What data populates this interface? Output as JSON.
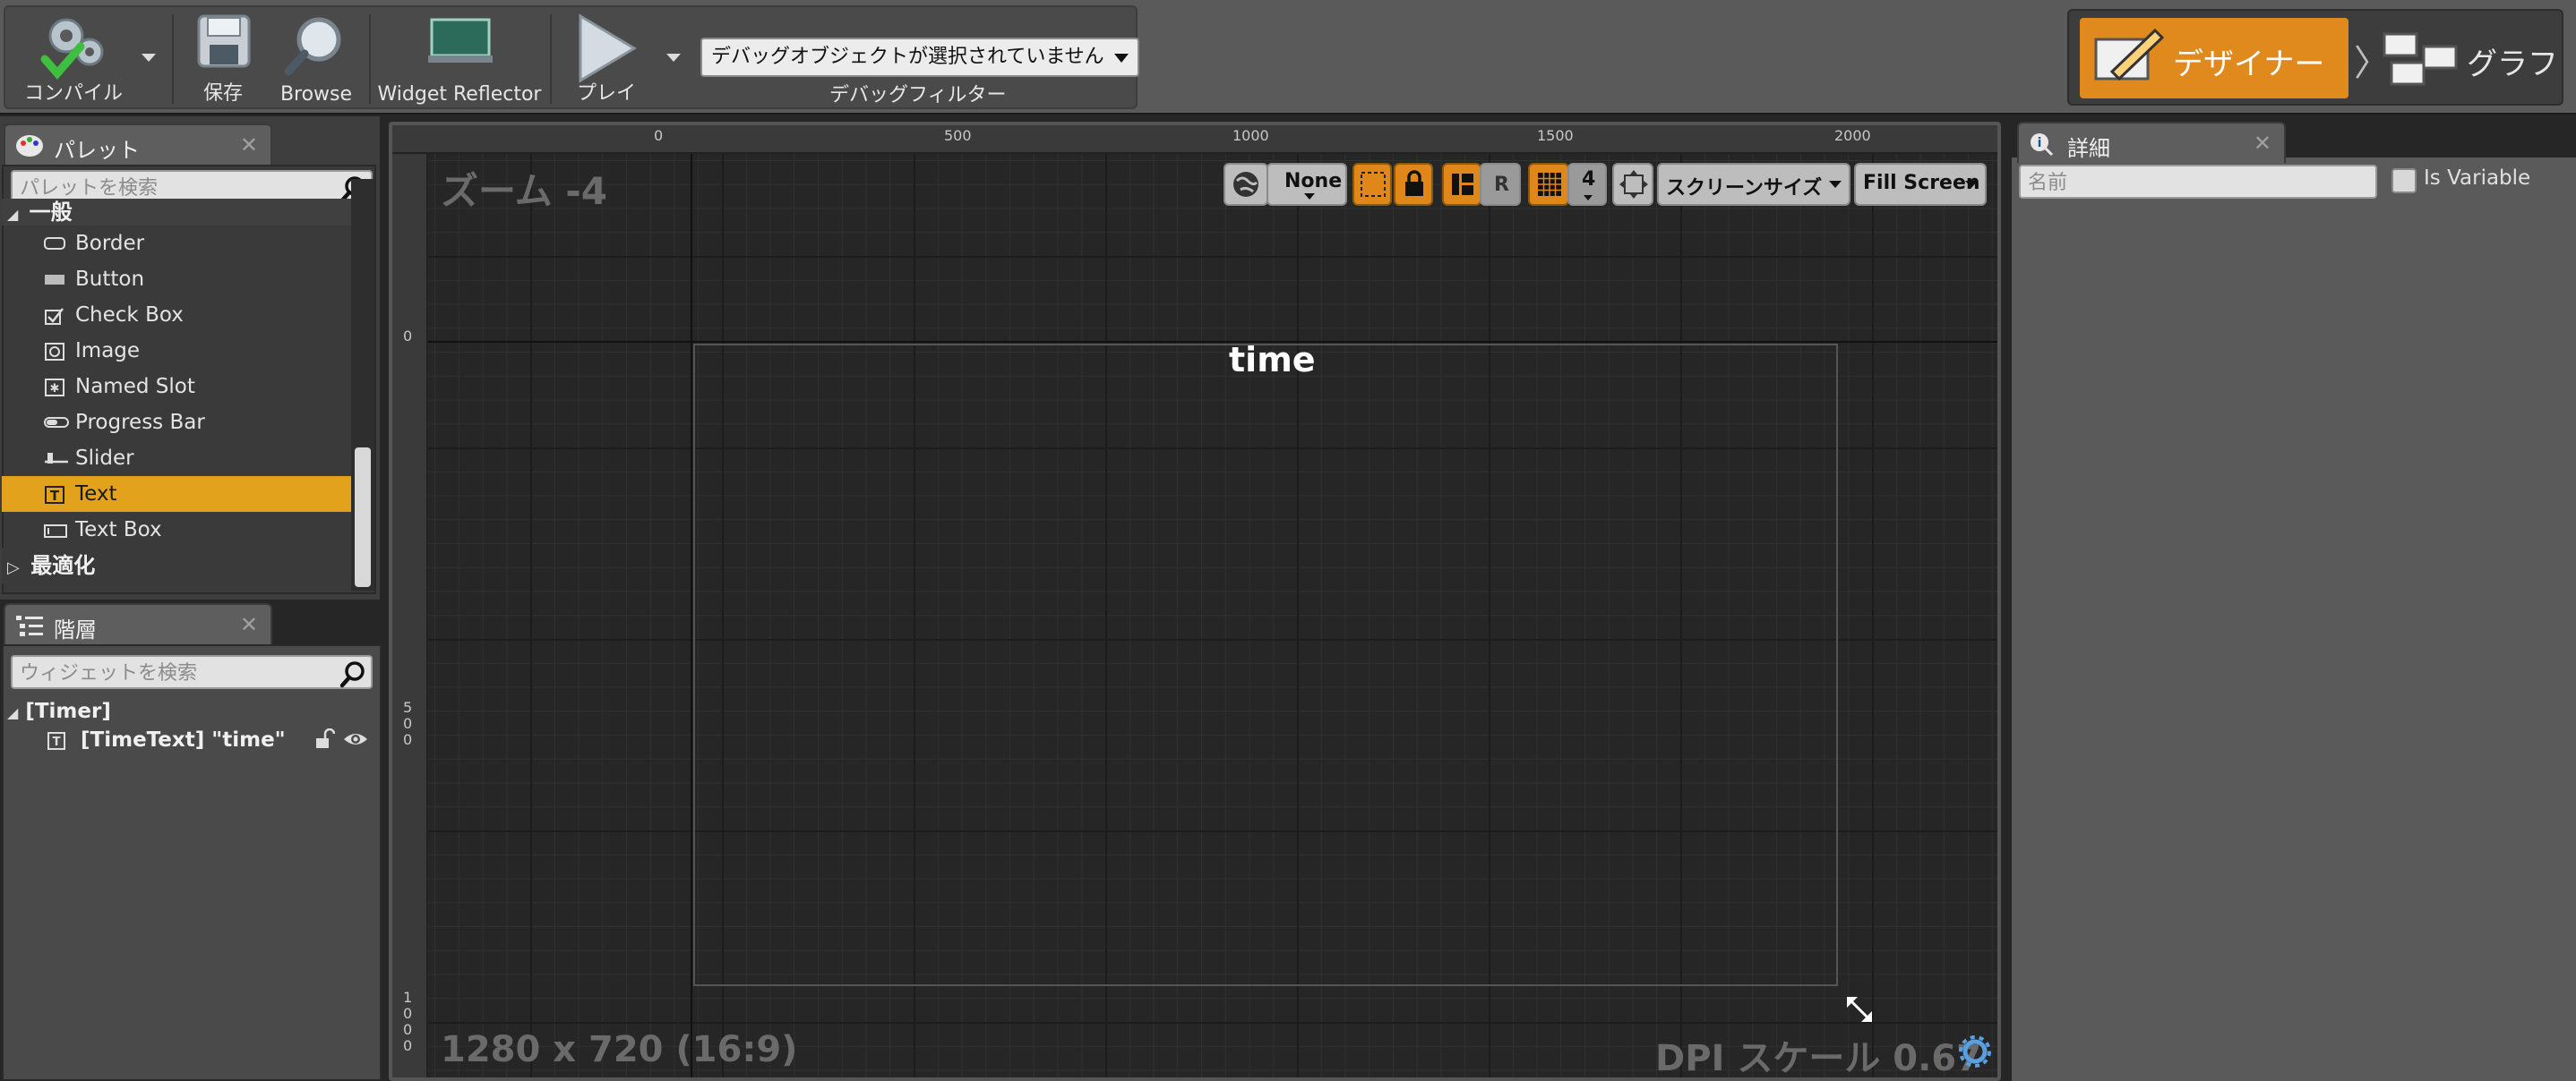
{
  "toolbar": {
    "compile_label": "コンパイル",
    "save_label": "保存",
    "browse_label": "Browse",
    "widget_reflector_label": "Widget Reflector",
    "play_label": "プレイ",
    "debug_select_value": "デバッグオブジェクトが選択されていません",
    "debug_filter_label": "デバッグフィルター",
    "mode_designer": "デザイナー",
    "mode_graph": "グラフ",
    "accent_color": "#e08a1e"
  },
  "palette": {
    "tab_label": "パレット",
    "close": "✕",
    "search_placeholder": "パレットを検索",
    "category_general": "一般",
    "category_optimization": "最適化",
    "items": [
      {
        "name": "Border",
        "icon": "border-icon"
      },
      {
        "name": "Button",
        "icon": "button-icon"
      },
      {
        "name": "Check Box",
        "icon": "checkbox-icon"
      },
      {
        "name": "Image",
        "icon": "image-icon"
      },
      {
        "name": "Named Slot",
        "icon": "named-slot-icon"
      },
      {
        "name": "Progress Bar",
        "icon": "progress-bar-icon"
      },
      {
        "name": "Slider",
        "icon": "slider-icon"
      },
      {
        "name": "Text",
        "icon": "text-icon"
      },
      {
        "name": "Text Box",
        "icon": "text-box-icon"
      }
    ],
    "selected_item": "Text",
    "selection_color": "#e2a21c"
  },
  "hierarchy": {
    "tab_label": "階層",
    "close": "✕",
    "search_placeholder": "ウィジェットを検索",
    "root": "[Timer]",
    "child": "[TimeText] \"time\""
  },
  "designer": {
    "zoom": "ズーム -4",
    "resolution": "1280 x 720 (16:9)",
    "dpi_scale": "DPI スケール 0.67",
    "widget_text": "time",
    "ruler_top": [
      "0",
      "500",
      "1000",
      "1500",
      "2000"
    ],
    "ruler_left": [
      "0",
      "5\n0\n0",
      "1\n0\n0\n0"
    ],
    "controls": {
      "none_label": "None",
      "r_label": "R",
      "grid_value": "4",
      "screen_size_label": "スクリーンサイズ",
      "fill_screen_label": "Fill Screen"
    }
  },
  "details": {
    "tab_label": "詳細",
    "close": "✕",
    "name_placeholder": "名前",
    "is_variable_label": "Is Variable"
  }
}
